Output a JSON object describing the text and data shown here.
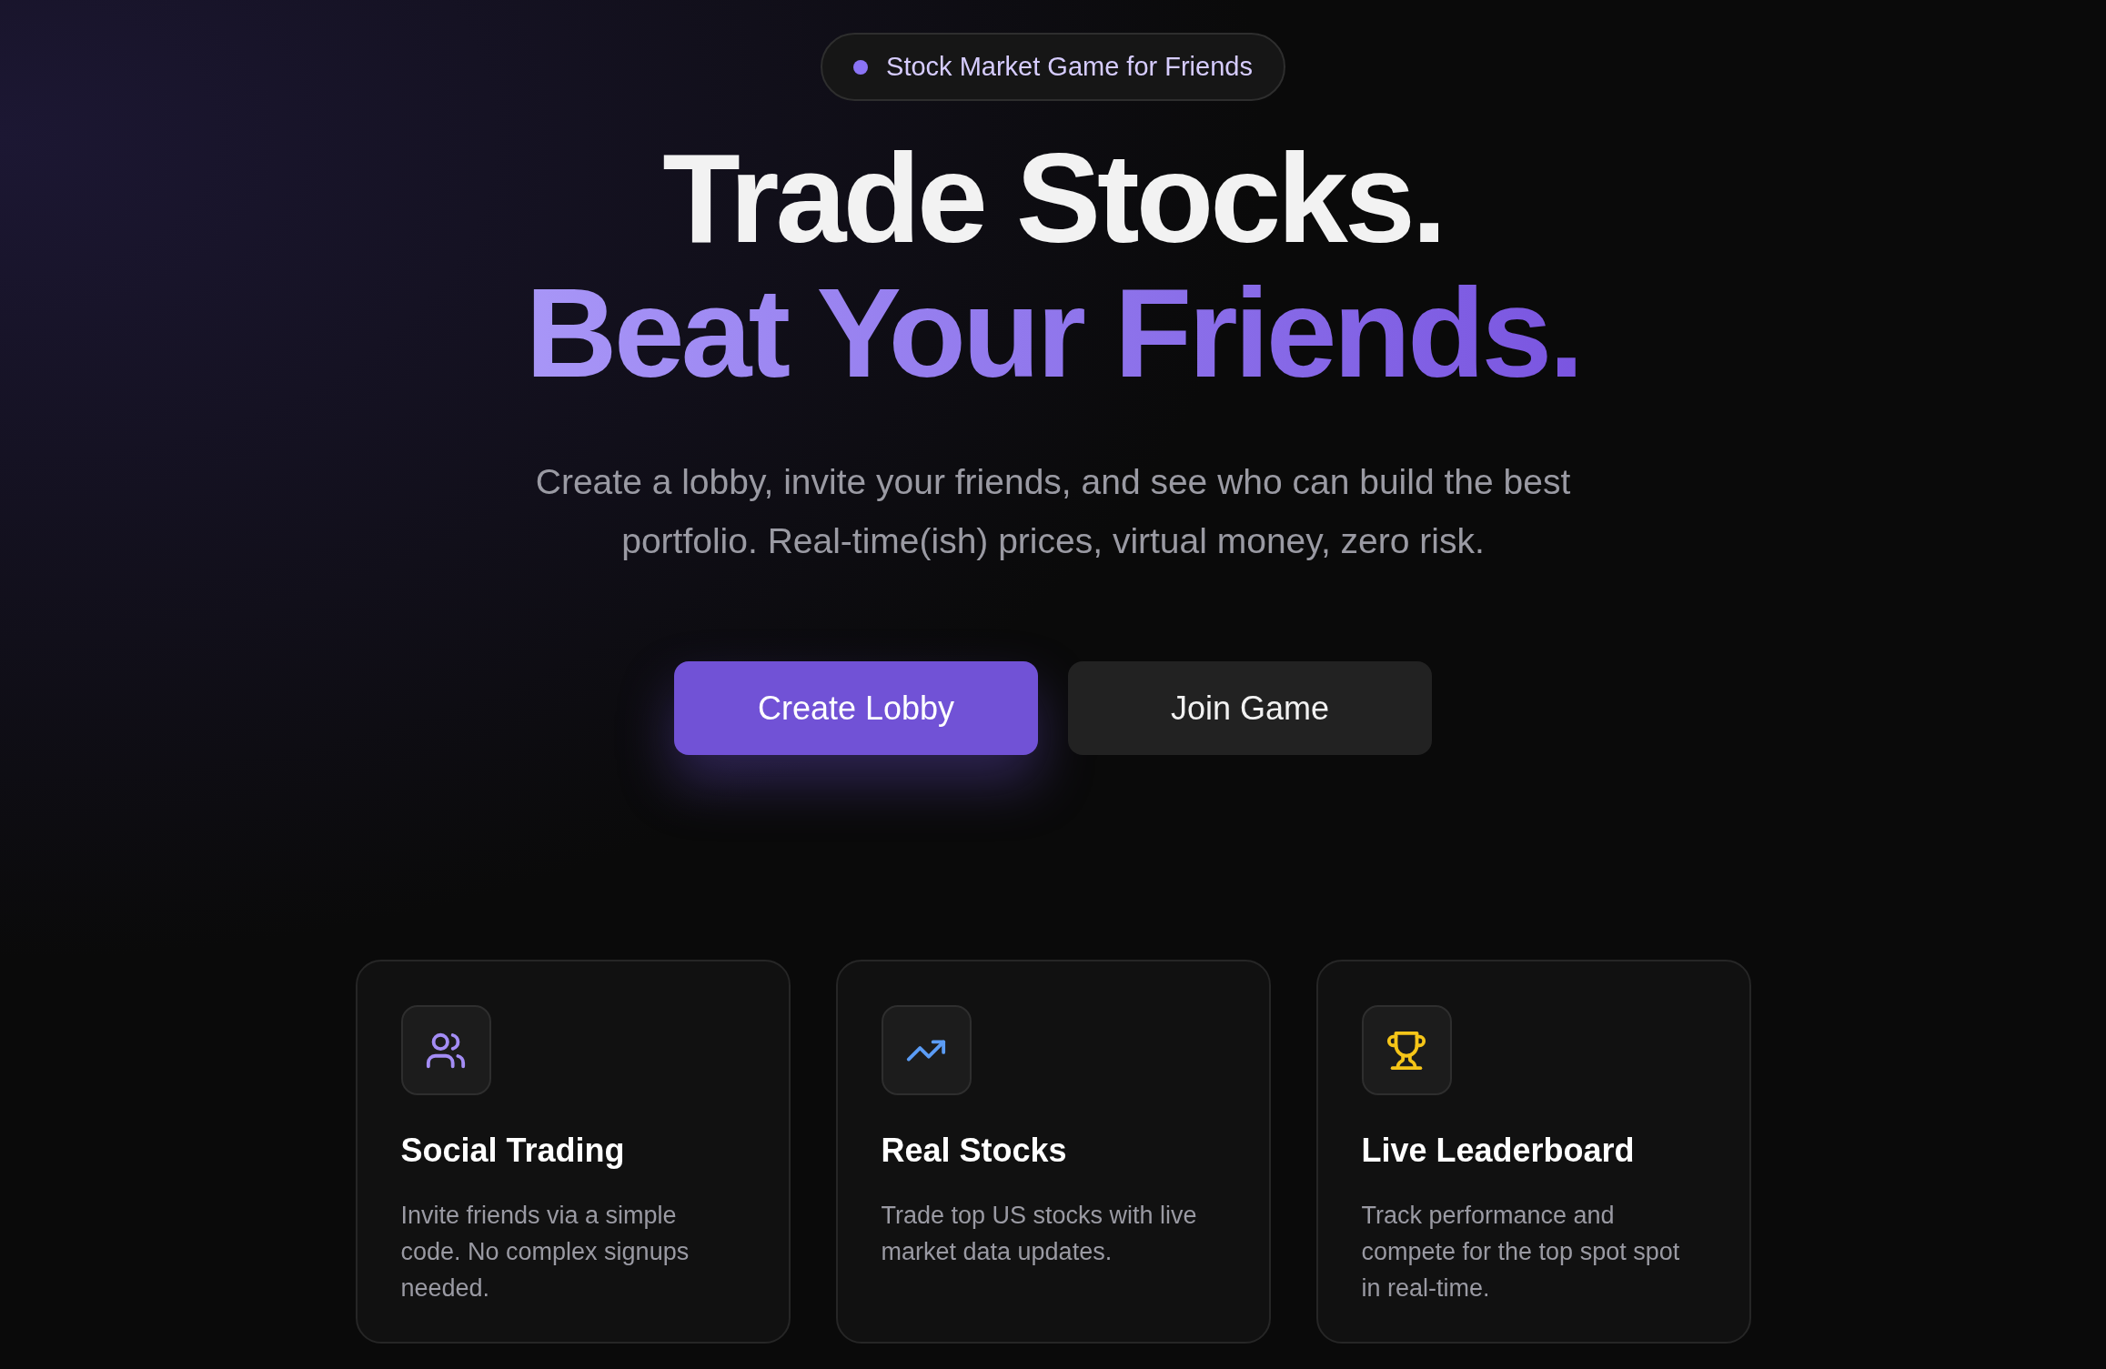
{
  "badge": {
    "label": "Stock Market Game for Friends"
  },
  "headline": {
    "line_1": "Trade Stocks.",
    "line_2": "Beat Your Friends."
  },
  "subtitle": "Create a lobby, invite your friends, and see who can build the best portfolio. Real-time(ish) prices, virtual money, zero risk.",
  "buttons": [
    {
      "label": "Create Lobby",
      "kind": "primary"
    },
    {
      "label": "Join Game",
      "kind": "secondary"
    }
  ],
  "features": [
    {
      "kind": "users",
      "title": "Social Trading",
      "text": "Invite friends via a simple code. No complex signups needed."
    },
    {
      "kind": "trend",
      "title": "Real Stocks",
      "text": "Trade top US stocks with live market data updates."
    },
    {
      "kind": "trophy",
      "title": "Live Leaderboard",
      "text": "Track performance and compete for the top spot spot in real-time."
    }
  ]
}
